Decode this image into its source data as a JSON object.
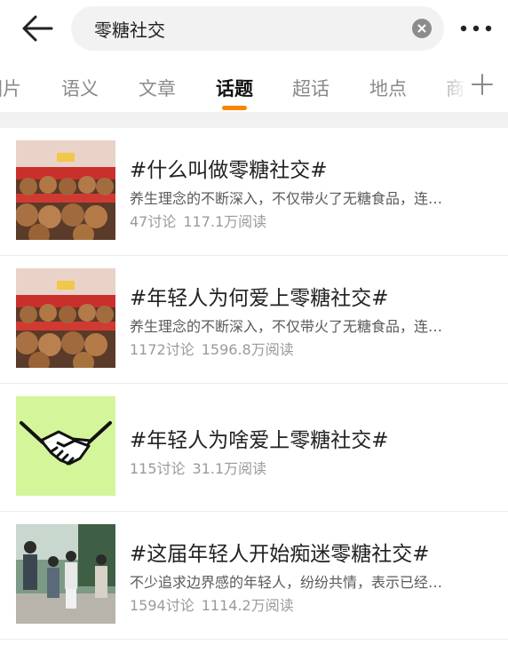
{
  "search": {
    "query": "零糖社交"
  },
  "tabs": [
    {
      "label": "图片"
    },
    {
      "label": "语义"
    },
    {
      "label": "文章"
    },
    {
      "label": "话题",
      "active": true
    },
    {
      "label": "超话"
    },
    {
      "label": "地点"
    },
    {
      "label": "商"
    }
  ],
  "topics": [
    {
      "title": "#什么叫做零糖社交#",
      "desc": "养生理念的不断深入，不仅带火了无糖食品，连…",
      "discussions": "47讨论",
      "reads": "117.1万阅读",
      "thumb_icon": "plush-toys-image"
    },
    {
      "title": "#年轻人为何爱上零糖社交#",
      "desc": "养生理念的不断深入，不仅带火了无糖食品，连…",
      "discussions": "1172讨论",
      "reads": "1596.8万阅读",
      "thumb_icon": "plush-toys-image"
    },
    {
      "title": "#年轻人为啥爱上零糖社交#",
      "desc": "",
      "discussions": "115讨论",
      "reads": "31.1万阅读",
      "thumb_icon": "handshake-icon"
    },
    {
      "title": "#这届年轻人开始痴迷零糖社交#",
      "desc": "不少追求边界感的年轻人，纷纷共情，表示已经…",
      "discussions": "1594讨论",
      "reads": "1114.2万阅读",
      "thumb_icon": "people-photo-image"
    }
  ],
  "colors": {
    "accent": "#ff8200",
    "handshake_bg": "#d4f59a"
  }
}
